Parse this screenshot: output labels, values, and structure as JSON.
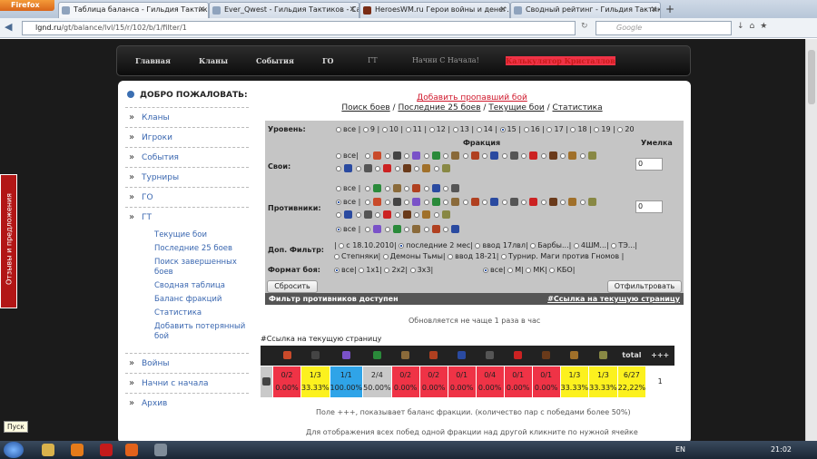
{
  "browser": {
    "app_button": "Firefox",
    "tabs": [
      "Таблица баланса - Гильдия Тактико...",
      "Ever_Qwest - Гильдия Тактиков - Са...",
      "HeroesWM.ru Герои войны и денег...",
      "Сводный рейтинг - Гильдия Тактик..."
    ],
    "new_tab": "+",
    "url_domain": "lgnd.ru",
    "url_path": "/gt/balance/lvl/15/r/102/b/1/filter/1",
    "search_placeholder": "Google"
  },
  "topnav": [
    "Главная",
    "Кланы",
    "События",
    "ГО",
    "ГТ",
    "Начни С Начала!",
    "Калькулятор Кристаллов"
  ],
  "sidebar": {
    "welcome": "ДОБРО ПОЖАЛОВАТЬ:",
    "items": [
      "Кланы",
      "Игроки",
      "События",
      "Турниры",
      "ГО",
      "ГТ"
    ],
    "sub_items": [
      "Текущие бои",
      "Последние 25 боев",
      "Поиск завершенных боев",
      "Сводная таблица",
      "Баланс фракций",
      "Статистика",
      "Добавить потерянный бой"
    ],
    "items_after": [
      "Войны",
      "Начни с начала",
      "Архив"
    ]
  },
  "main": {
    "add_link": "Добавить пропавший бой",
    "nav_links": [
      "Поиск боев",
      "Последние 25 боев",
      "Текущие бои",
      "Статистика"
    ]
  },
  "filter": {
    "level_label": "Уровень:",
    "levels": [
      "все",
      "9",
      "10",
      "11",
      "12",
      "13",
      "14",
      "15",
      "16",
      "17",
      "18",
      "19",
      "20"
    ],
    "selected_level": "15",
    "fraction_header": "Фракция",
    "skill_header": "Умелка",
    "own_label": "Свои:",
    "opp_label": "Противники:",
    "own_skill": "0",
    "opp_skill": "0",
    "all_label": "все",
    "extra_label": "Доп. Фильтр:",
    "extra_opts_1": "с 18.10.2010",
    "extra_opts_2": "последние 2 мес",
    "extra_opts_3": "ввод 17лвл",
    "extra_opts_4": "Барбы...",
    "extra_opts_5": "4ШМ...",
    "extra_opts_6": "ТЭ...",
    "extra_opts_7": "Степняки",
    "extra_opts_8": "Демоны Тьмы",
    "extra_opts_9": "ввод 18-21",
    "extra_opts_10": "Турнир. Маги против Гномов",
    "format_label": "Формат боя:",
    "format_opts": [
      "все",
      "1x1",
      "2x2",
      "3x3"
    ],
    "format_opts2": [
      "все",
      "М",
      "МК",
      "КБО"
    ],
    "reset_btn": "Сбросить",
    "filter_btn": "Отфильтровать",
    "bar_left": "Фильтр противников доступен",
    "bar_right": "#Ссылка на текущую страницу"
  },
  "note_updates": "Обновляется не чаще 1 раза в час",
  "page_link": "#Ссылка на текущую страницу",
  "balance": {
    "total_label": "total",
    "plus_label": "+++",
    "rows": [
      {
        "vals": [
          "0/2",
          "1/3",
          "1/1",
          "2/4",
          "0/2",
          "0/2",
          "0/1",
          "0/4",
          "0/1",
          "0/1",
          "1/3",
          "1/3",
          "6/27"
        ],
        "pcts": [
          "0.00%",
          "33.33%",
          "100.00%",
          "50.00%",
          "0.00%",
          "0.00%",
          "0.00%",
          "0.00%",
          "0.00%",
          "0.00%",
          "33.33%",
          "33.33%",
          "22,22%"
        ],
        "plus": "1"
      }
    ]
  },
  "note_bottom_1": "Поле +++, показывает баланс фракции. (количество пар с победами более 50%)",
  "note_bottom_2": "Для отображения всех побед одной фракции над другой кликните по нужной ячейке",
  "feedback": "Отзывы и предложения",
  "tooltip": "Пуск",
  "taskbar": {
    "lang": "EN",
    "clock": "21:02"
  },
  "colors": {
    "red": "#ef3346",
    "yellow": "#fcf11e",
    "blue": "#2fa4e8",
    "gray": "#c9c9c9"
  }
}
